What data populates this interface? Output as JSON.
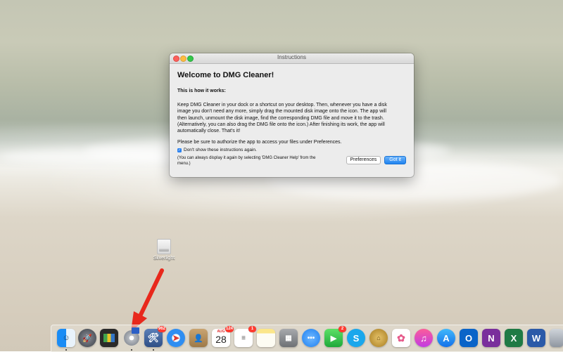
{
  "dialog": {
    "window_title": "Instructions",
    "heading": "Welcome to DMG Cleaner!",
    "subheading": "This is how it works:",
    "paragraph_lines": [
      "Keep DMG Cleaner in your dock or a shortcut on your desktop. Then, whenever you have a disk",
      "image you don't need any more, simply drag the mounted disk image onto the icon. The app will",
      "then launch, unmount the disk image, find the corresponding DMG file and move it to the trash.",
      "(Alternatively, you can also drag the DMG file onto the icon.) After finishing its work, the app will",
      "automatically close. That's it!"
    ],
    "authorize_text": "Please be sure to authorize the app to access your files under Preferences.",
    "checkbox_label": "Don't show these instructions again.",
    "checkbox_checked": true,
    "hint_lines": [
      "(You can always display it again by selecting 'DMG Cleaner Help' from the",
      "menu.)"
    ],
    "preferences_label": "Preferences",
    "got_it_label": "Got it"
  },
  "desktop": {
    "icon_label": "Silverlight"
  },
  "dock": {
    "badges": {
      "app_badge": "962",
      "calendar_month": "AUG",
      "calendar_badge": "124",
      "calendar_day": "28",
      "reminders_badge": "1",
      "facetime_badge": "2"
    }
  },
  "colors": {
    "accent_blue": "#1f83f0",
    "badge_red": "#ff3b30",
    "arrow_red": "#e8281c"
  }
}
